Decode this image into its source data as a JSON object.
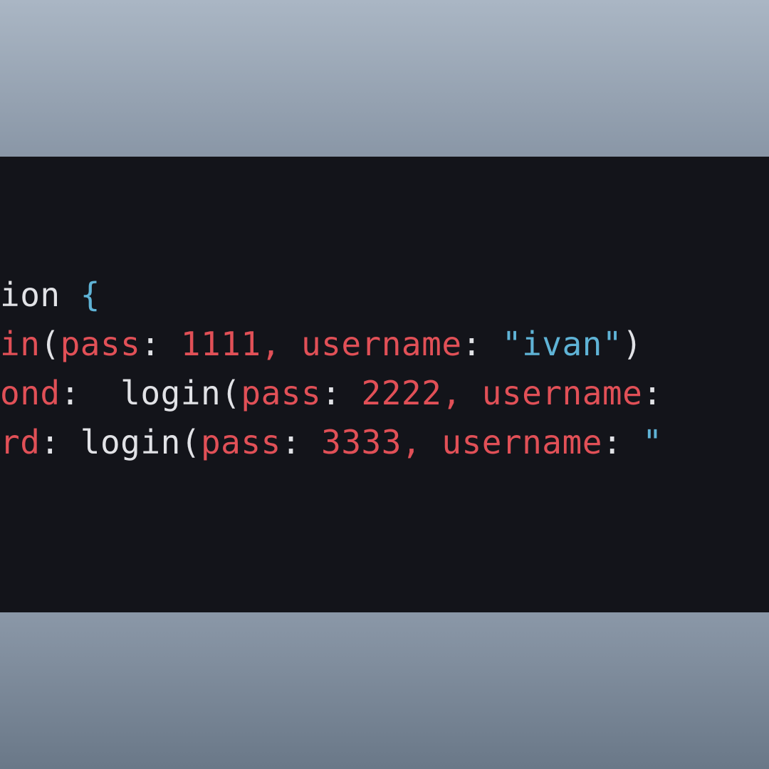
{
  "editor": {
    "lines": {
      "l1": {
        "frag1": "ion ",
        "frag2": "{"
      },
      "l2": {
        "frag1": "in",
        "frag2": "(",
        "frag3": "pass",
        "frag4": ": ",
        "frag5": "1111",
        "frag6": ",",
        "frag7": " ",
        "frag8": "username",
        "frag9": ": ",
        "frag10": "\"ivan\"",
        "frag11": ")"
      },
      "l3": {
        "frag1": "ond",
        "frag2": ":",
        "frag3": "  login",
        "frag4": "(",
        "frag5": "pass",
        "frag6": ": ",
        "frag7": "2222",
        "frag8": ",",
        "frag9": " ",
        "frag10": "username",
        "frag11": ":"
      },
      "l4": {
        "frag1": "rd",
        "frag2": ":",
        "frag3": " login",
        "frag4": "(",
        "frag5": "pass",
        "frag6": ": ",
        "frag7": "3333",
        "frag8": ",",
        "frag9": " ",
        "frag10": "username",
        "frag11": ": ",
        "frag12": "\""
      }
    }
  }
}
